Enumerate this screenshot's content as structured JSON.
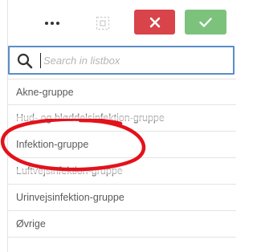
{
  "toolbar": {
    "more_icon": "more-horizontal-icon",
    "select_icon": "selection-icon",
    "cancel_icon": "close-icon",
    "confirm_icon": "check-icon",
    "cancel_color": "#d9434a",
    "confirm_color": "#7cc27d"
  },
  "search": {
    "placeholder": "Search in listbox",
    "value": "",
    "icon": "search-icon",
    "border_color": "#5a8ec9"
  },
  "listbox": {
    "items": [
      {
        "label": "Akne-gruppe"
      },
      {
        "label": "Hud- og bløddelsinfektion-gruppe"
      },
      {
        "label": "Infektion-gruppe"
      },
      {
        "label": "Luftvejsinfektion-gruppe"
      },
      {
        "label": "Urinvejsinfektion-gruppe"
      },
      {
        "label": "Øvrige"
      }
    ]
  },
  "annotation": {
    "highlighted_item": "Infektion-gruppe",
    "color": "#e3121b"
  }
}
